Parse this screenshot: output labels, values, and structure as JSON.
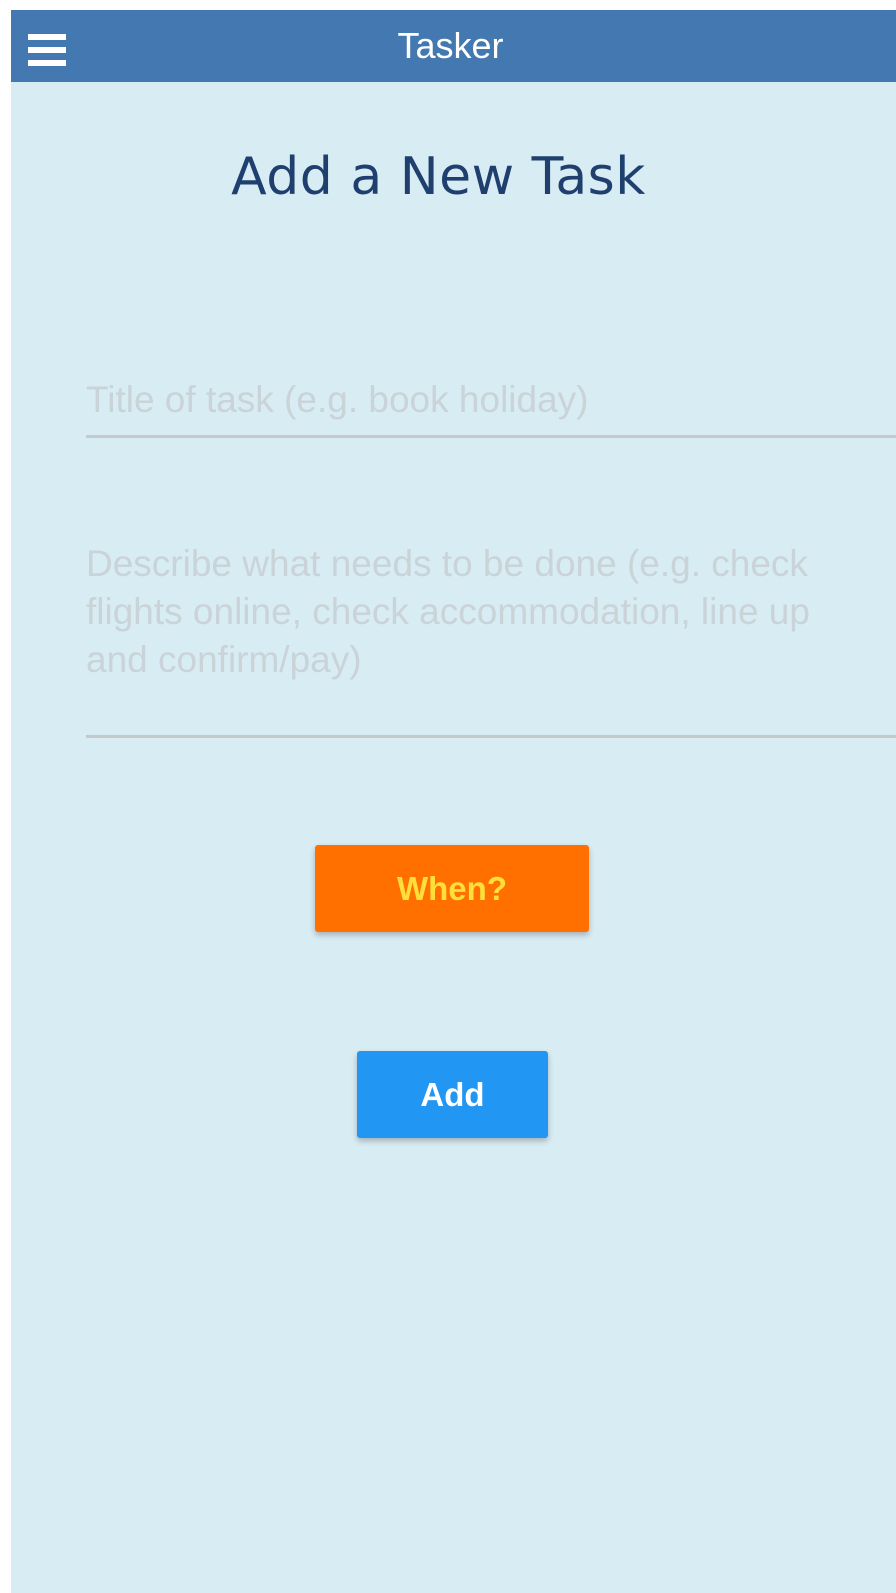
{
  "header": {
    "title": "Tasker",
    "menu_icon": "hamburger-menu-icon"
  },
  "page": {
    "heading": "Add a New Task"
  },
  "form": {
    "title_placeholder": "Title of task (e.g. book holiday)",
    "title_value": "",
    "description_placeholder": "Describe what needs to be done (e.g. check flights online, check accommodation, line up and confirm/pay)",
    "description_value": "",
    "when_label": "When?",
    "add_label": "Add"
  },
  "colors": {
    "header_bg": "#4478b0",
    "page_bg": "#d8ecf3",
    "heading": "#1f3f6e",
    "when_button_bg": "#ff7000",
    "when_button_text": "#ffe03a",
    "add_button_bg": "#2196f3"
  }
}
